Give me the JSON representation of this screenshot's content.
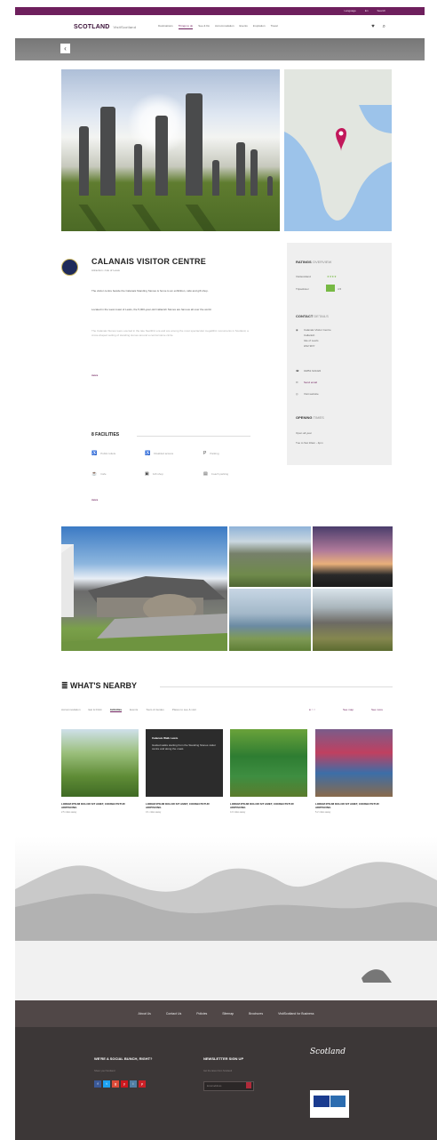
{
  "topbar": {
    "items": [
      "Language",
      "En",
      "Search"
    ]
  },
  "header": {
    "logo": "SCOTLAND",
    "logo_sub": "VisitScotland",
    "nav": [
      "Destinations",
      "Things to do",
      "See & Do",
      "Accommodation",
      "Events",
      "Inspiration",
      "Travel"
    ],
    "active_nav_index": 1,
    "icons": [
      "heart-icon",
      "search-icon"
    ]
  },
  "venue": {
    "title": "CALANAIS VISITOR CENTRE",
    "subtitle": "Attraction  •  Isle of Lewis",
    "description": [
      "The visitor centre beside the Calanais Standing Stones is home to an exhibition, café and gift shop.",
      "Located in the west coast of Lewis, the 5,000-year-old Callanish Stones are famous all over the world.",
      "The Calanais Stones were erected in the late Neolithic era and are among the most spectacular megalithic monuments in Scotland, a cross-shaped setting of standing stones around a central stone circle."
    ],
    "read_more": "more",
    "facilities_title": "8 FACILITIES",
    "facilities": [
      {
        "icon": "toilet-icon",
        "label": "Public toilets"
      },
      {
        "icon": "wheelchair-icon",
        "label": "Disabled access"
      },
      {
        "icon": "parking-icon",
        "label": "Parking"
      },
      {
        "icon": "cafe-icon",
        "label": "Cafe"
      },
      {
        "icon": "shop-icon",
        "label": "Gift shop"
      },
      {
        "icon": "coach-icon",
        "label": "Coach parking"
      }
    ],
    "more_facilities": "more"
  },
  "sidebar": {
    "ratings_title": "RATINGS",
    "ratings_sub": "OVERVIEW",
    "ratings": [
      {
        "label": "Visitscotland",
        "value": "★★★★"
      },
      {
        "label": "Tripadvisor",
        "value": "4.5"
      }
    ],
    "contact_title": "CONTACT",
    "contact_sub": "DETAILS",
    "address": [
      "Calanais Visitor Centre",
      "Callanish",
      "Isle of Lewis",
      "HS2 9DY"
    ],
    "phone": "01851 621422",
    "email": "Send email",
    "website": "Visit website",
    "opening_title": "OPENING",
    "opening_sub": "TIMES",
    "opening": [
      "Open all year",
      "Tue to Sat 10am - 4pm"
    ]
  },
  "whats_nearby": {
    "title": "WHAT'S NEARBY",
    "tabs": [
      "Accommodation",
      "Eat & Drink",
      "Activities",
      "Events",
      "Tours & Guides",
      "Places to see & visit"
    ],
    "active_tab_index": 2,
    "controls": [
      "See map",
      "See more"
    ],
    "cards": [
      {
        "caption": "LOREM IPSUM DOLOR SIT AMET, CONSECTETUR ADIPISCING",
        "meta": "2.5 miles away"
      },
      {
        "caption": "LOREM IPSUM DOLOR SIT AMET, CONSECTETUR ADIPISCING",
        "meta": "3.1 miles away",
        "overlay_title": "Calanais Walk Lewis",
        "overlay_text": "Guided walks starting from the Standing Stones visitor centre and along the coast."
      },
      {
        "caption": "LOREM IPSUM DOLOR SIT AMET, CONSECTETUR ADIPISCING",
        "meta": "4.0 miles away"
      },
      {
        "caption": "LOREM IPSUM DOLOR SIT AMET, CONSECTETUR ADIPISCING",
        "meta": "5.2 miles away"
      }
    ]
  },
  "footer": {
    "nav": [
      "About Us",
      "Contact Us",
      "Policies",
      "Sitemap",
      "Brochures",
      "VisitScotland for Business"
    ],
    "social_title": "WE'RE A SOCIAL BUNCH, RIGHT?",
    "social_sub": "Share your Scotland",
    "social": [
      "f",
      "t",
      "g",
      "y",
      "i",
      "p"
    ],
    "social_colors": [
      "#3b5998",
      "#1da1f2",
      "#dd4b39",
      "#cc181e",
      "#517fa4",
      "#cb2027"
    ],
    "newsletter_title": "NEWSLETTER SIGN UP",
    "newsletter_sub": "Get the latest from Scotland",
    "newsletter_placeholder": "Email address",
    "brand_logo": "Scotland"
  }
}
